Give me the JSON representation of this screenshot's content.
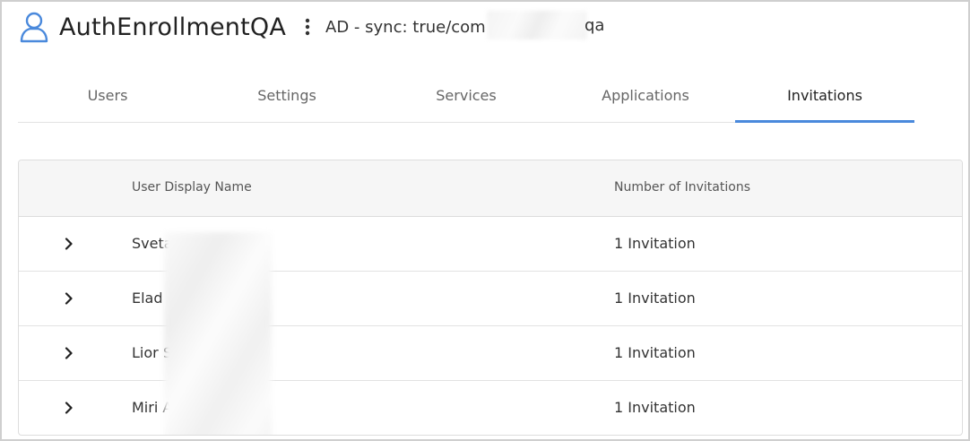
{
  "header": {
    "app_title": "AuthEnrollmentQA",
    "sync_info": "AD - sync: true/com",
    "sync_tail": "qa",
    "icon": "user-icon",
    "menu_icon": "kebab-menu-icon"
  },
  "tabs": [
    {
      "label": "Users",
      "active": false
    },
    {
      "label": "Settings",
      "active": false
    },
    {
      "label": "Services",
      "active": false
    },
    {
      "label": "Applications",
      "active": false
    },
    {
      "label": "Invitations",
      "active": true
    }
  ],
  "table": {
    "columns": {
      "user_display_name": "User Display Name",
      "number_of_invitations": "Number of Invitations"
    },
    "rows": [
      {
        "name": "Sveta",
        "count": "1 Invitation"
      },
      {
        "name": "Elad",
        "count": "1 Invitation"
      },
      {
        "name": "Lior S",
        "count": "1 Invitation"
      },
      {
        "name": "Miri A",
        "count": "1 Invitation"
      }
    ]
  },
  "colors": {
    "accent": "#4a89dc",
    "icon_blue": "#4a89dc"
  }
}
